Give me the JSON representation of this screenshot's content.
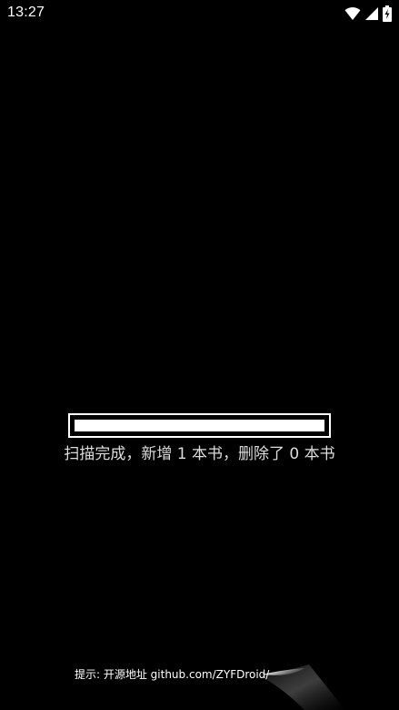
{
  "status_bar": {
    "time": "13:27",
    "icons": [
      "wifi-icon",
      "cell-signal-icon",
      "battery-charging-icon"
    ]
  },
  "scan": {
    "progress": 1.0,
    "message": "扫描完成，新增 1 本书，删除了 0 本书"
  },
  "footer": {
    "tip": "提示: 开源地址 github.com/ZYFDroid/"
  },
  "colors": {
    "background": "#000000",
    "foreground": "#ffffff",
    "message_text": "#dddddd"
  }
}
